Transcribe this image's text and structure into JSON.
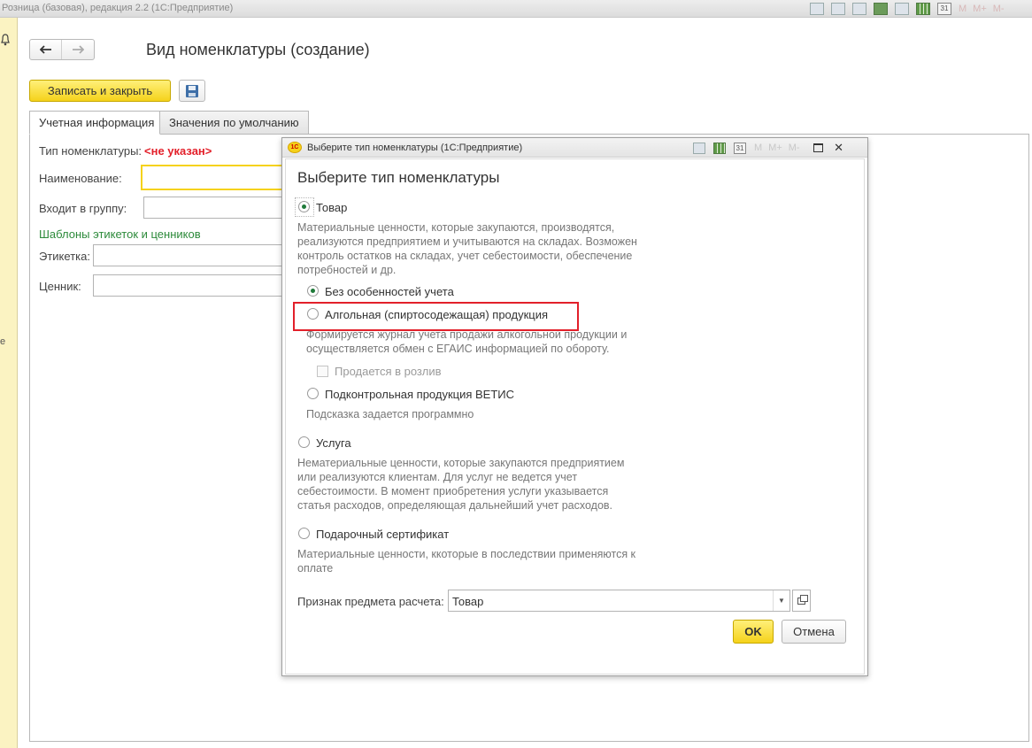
{
  "app": {
    "title": "Розница (базовая), редакция 2.2  (1С:Предприятие)",
    "toolbar_m": [
      "M",
      "M+",
      "M-"
    ],
    "calendar_day": "31"
  },
  "form": {
    "title": "Вид номенклатуры  (создание)",
    "save_close_label": "Записать и закрыть",
    "tabs": [
      "Учетная информация",
      "Значения по умолчанию"
    ],
    "type_label": "Тип номенклатуры:",
    "type_value": "<не указан>",
    "name_label": "Наименование:",
    "group_label": "Входит в группу:",
    "templates_label": "Шаблоны этикеток и ценников",
    "label_label": "Этикетка:",
    "price_tag_label": "Ценник:",
    "strip_letter": "е"
  },
  "dialog": {
    "window_title": "Выберите тип номенклатуры  (1С:Предприятие)",
    "logo": "1С",
    "heading": "Выберите тип номенклатуры",
    "toolbar_m": [
      "M",
      "M+",
      "M-"
    ],
    "calendar_day": "31",
    "options": {
      "goods": {
        "label": "Товар",
        "checked": true,
        "desc": [
          "Материальные ценности, которые закупаются, производятся,",
          "реализуются предприятием и учитываются на складах. Возможен",
          "контроль остатков на складах, учет себестоимости, обеспечение",
          "потребностей и др."
        ]
      },
      "no_features": {
        "label": "Без особенностей учета",
        "checked": true
      },
      "alcohol": {
        "label": "Алгольная (спиртосодежащая) продукция",
        "checked": false,
        "desc": [
          "Формируется журнал учета продажи алкогольной продукции и",
          "осуществляется обмен с ЕГАИС информацией по обороту."
        ]
      },
      "draft": {
        "label": "Продается в розлив",
        "checked": false
      },
      "vetis": {
        "label": "Подконтрольная продукция ВЕТИС",
        "checked": false,
        "desc": "Подсказка задается программно"
      },
      "service": {
        "label": "Услуга",
        "checked": false,
        "desc": [
          "Нематериальные ценности, которые закупаются предприятием",
          "или реализуются клиентам. Для услуг не ведется учет",
          "себестоимости. В момент приобретения услуги указывается",
          "статья расходов, определяющая дальнейший учет расходов."
        ]
      },
      "gift": {
        "label": "Подарочный сертификат",
        "checked": false,
        "desc": [
          "Материальные ценности, ккоторые в последствии применяются к",
          "оплате"
        ]
      }
    },
    "payment_subject_label": "Признак предмета расчета:",
    "payment_subject_value": "Товар",
    "ok_label": "OK",
    "cancel_label": "Отмена"
  }
}
